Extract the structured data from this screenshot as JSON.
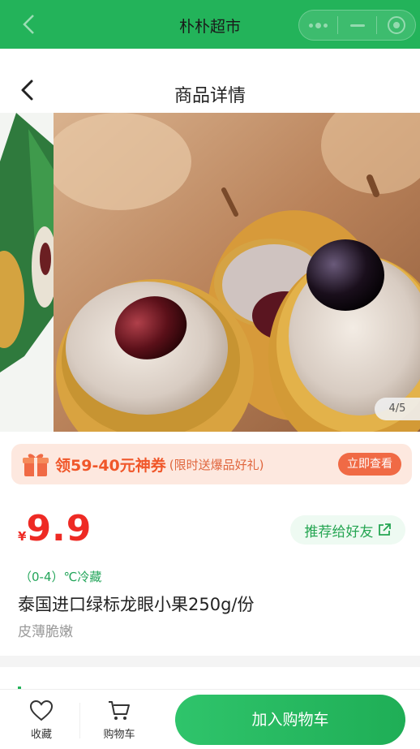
{
  "mini_program": {
    "title": "朴朴超市",
    "back_icon": "chevron-left-icon",
    "capsule": {
      "more_icon": "more-dots-icon",
      "minimize_icon": "minimize-icon",
      "close_icon": "target-close-icon"
    },
    "bar_color": "#23b35a"
  },
  "page": {
    "title": "商品详情",
    "back_icon": "chevron-left-icon"
  },
  "gallery": {
    "indicator": "4/5"
  },
  "coupon": {
    "icon": "gift-icon",
    "main": "领59-40元神券",
    "sub": "(限时送爆品好礼)",
    "button": "立即查看"
  },
  "product": {
    "currency": "¥",
    "price": "9.9",
    "share_label": "推荐给好友",
    "share_icon": "external-share-icon",
    "storage": "（0-4）℃冷藏",
    "name": "泰国进口绿标龙眼小果250g/份",
    "description": "皮薄脆嫩"
  },
  "bottom_bar": {
    "favorite_label": "收藏",
    "favorite_icon": "heart-icon",
    "cart_label": "购物车",
    "cart_icon": "cart-icon",
    "add_to_cart": "加入购物车"
  },
  "colors": {
    "brand_green": "#23b35a",
    "price_red": "#ee2a24",
    "coupon_orange": "#f06a45"
  }
}
